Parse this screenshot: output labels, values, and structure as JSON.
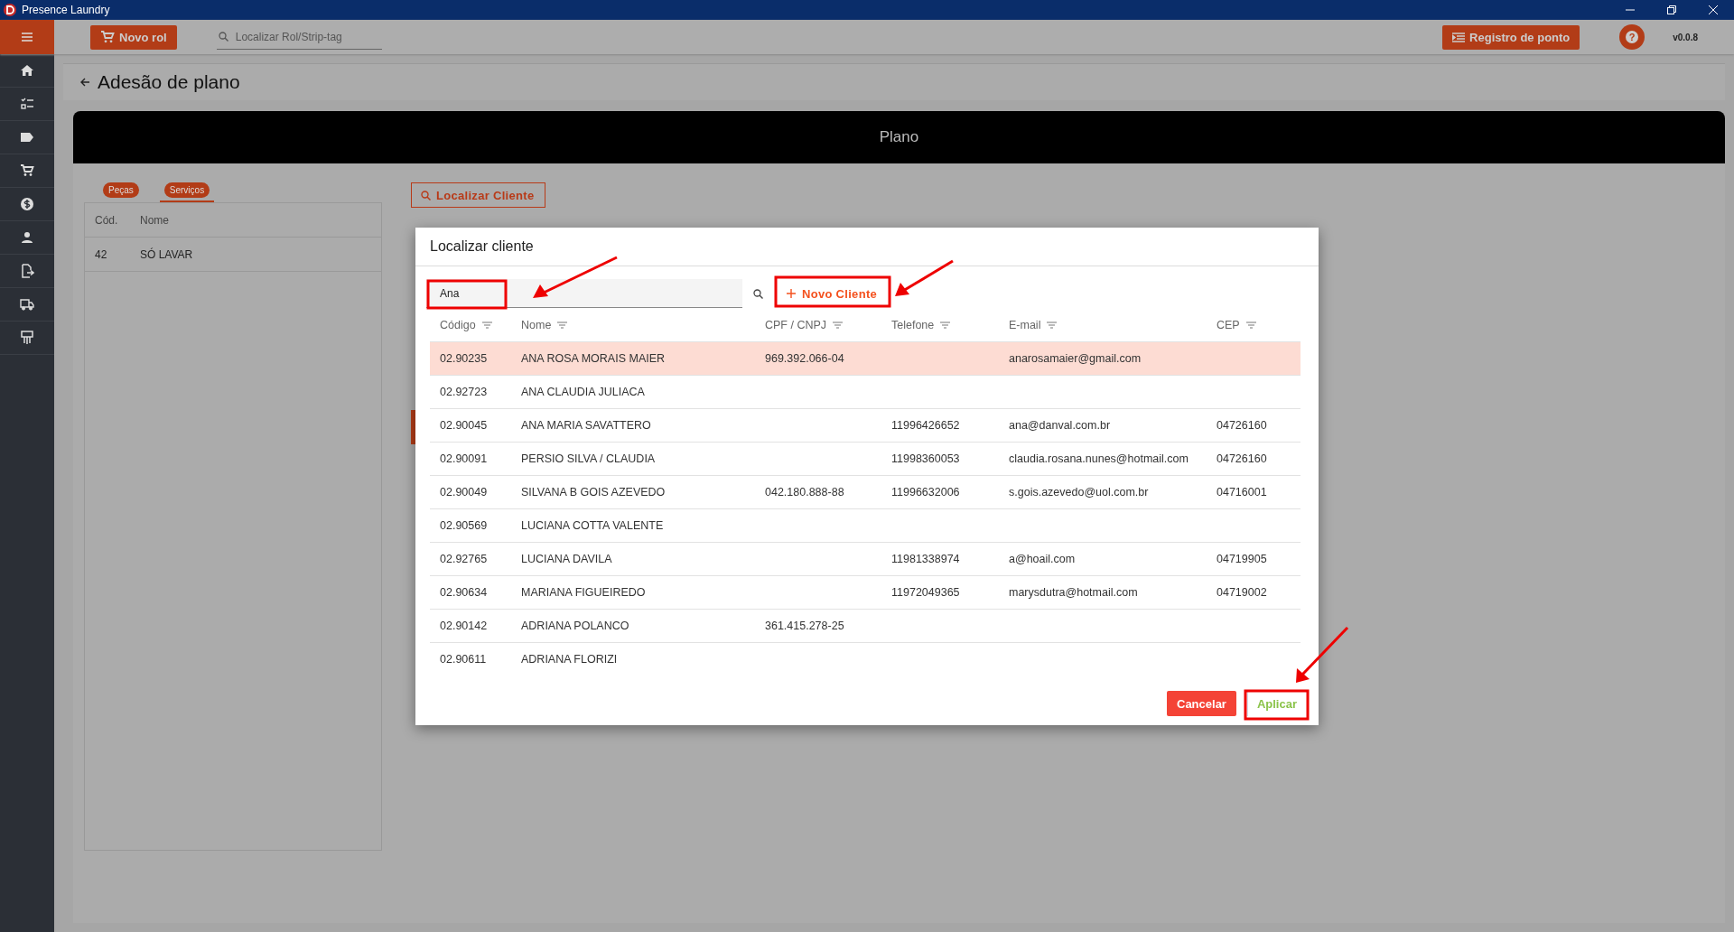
{
  "window": {
    "title": "Presence Laundry"
  },
  "toolbar": {
    "new_button": "Novo rol",
    "search": {
      "placeholder": "Localizar Rol/Strip-tag"
    },
    "clock_button": "Registro de ponto",
    "help": "?",
    "version": "v0.0.8"
  },
  "page": {
    "title": "Adesão de plano",
    "banner": "Plano",
    "tabs": [
      {
        "label": "Peças",
        "selected": false
      },
      {
        "label": "Serviços",
        "selected": true
      }
    ],
    "table": {
      "columns": [
        "Cód.",
        "Nome"
      ],
      "rows": [
        [
          "42",
          "SÓ LAVAR"
        ]
      ]
    },
    "find_button": "Localizar Cliente"
  },
  "dialog": {
    "title": "Localizar cliente",
    "search": {
      "value": "Ana"
    },
    "new_button": "Novo Cliente",
    "columns": [
      "Código",
      "Nome",
      "CPF / CNPJ",
      "Telefone",
      "E-mail",
      "CEP"
    ],
    "rows": [
      {
        "cells": [
          "02.90235",
          "ANA ROSA MORAIS MAIER",
          "969.392.066-04",
          "",
          "anarosamaier@gmail.com",
          ""
        ],
        "selected": true
      },
      {
        "cells": [
          "02.92723",
          "ANA CLAUDIA JULIACA",
          "",
          "",
          "",
          ""
        ],
        "selected": false
      },
      {
        "cells": [
          "02.90045",
          "ANA MARIA SAVATTERO",
          "",
          "11996426652",
          "ana@danval.com.br",
          "04726160"
        ],
        "selected": false
      },
      {
        "cells": [
          "02.90091",
          "PERSIO SILVA / CLAUDIA",
          "",
          "11998360053",
          "claudia.rosana.nunes@hotmail.com",
          "04726160"
        ],
        "selected": false
      },
      {
        "cells": [
          "02.90049",
          "SILVANA B GOIS AZEVEDO",
          "042.180.888-88",
          "11996632006",
          "s.gois.azevedo@uol.com.br",
          "04716001"
        ],
        "selected": false
      },
      {
        "cells": [
          "02.90569",
          "LUCIANA COTTA VALENTE",
          "",
          "",
          "",
          ""
        ],
        "selected": false
      },
      {
        "cells": [
          "02.92765",
          "LUCIANA DAVILA",
          "",
          "11981338974",
          "a@hoail.com",
          "04719905"
        ],
        "selected": false
      },
      {
        "cells": [
          "02.90634",
          "MARIANA FIGUEIREDO",
          "",
          "11972049365",
          "marysdutra@hotmail.com",
          "04719002"
        ],
        "selected": false
      },
      {
        "cells": [
          "02.90142",
          "ADRIANA POLANCO",
          "361.415.278-25",
          "",
          "",
          ""
        ],
        "selected": false
      },
      {
        "cells": [
          "02.90611",
          "ADRIANA FLORIZI",
          "",
          "",
          "",
          ""
        ],
        "selected": false
      }
    ],
    "cancel_button": "Cancelar",
    "apply_button": "Aplicar"
  }
}
